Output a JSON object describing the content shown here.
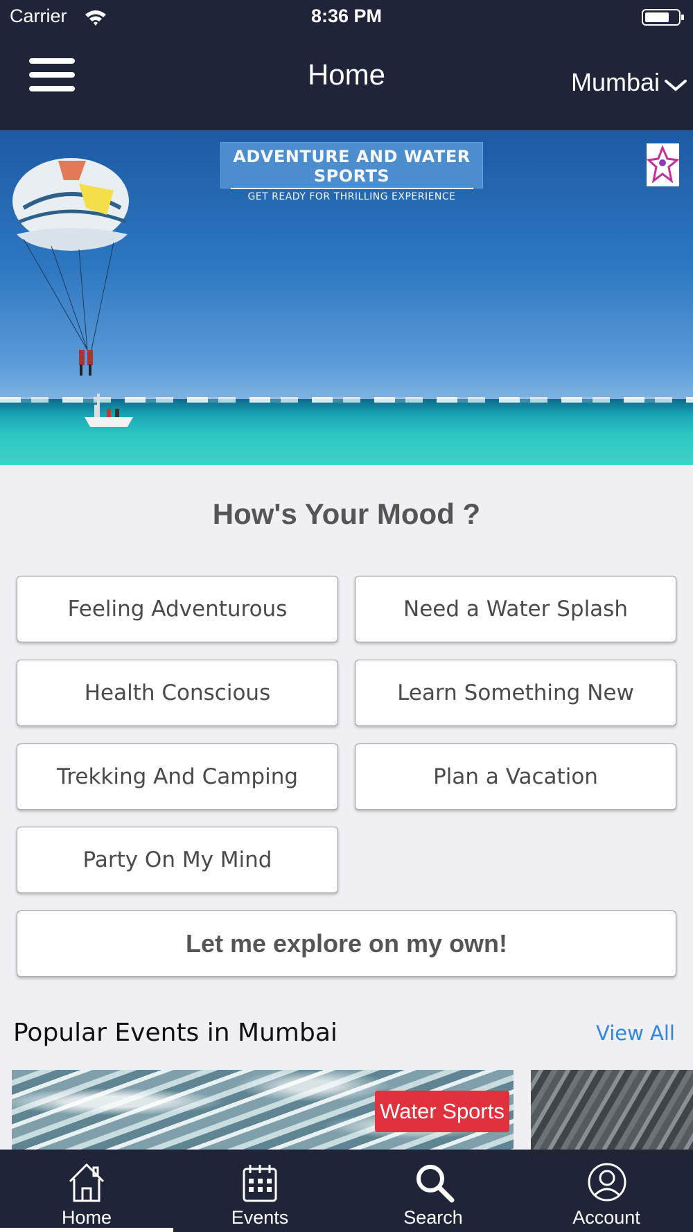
{
  "status_bar": {
    "carrier": "Carrier",
    "time": "8:36 PM"
  },
  "header": {
    "title": "Home",
    "city": "Mumbai"
  },
  "banner": {
    "headline": "ADVENTURE AND WATER SPORTS",
    "tagline": "GET READY FOR THRILLING EXPERIENCE"
  },
  "mood": {
    "title": "How's Your Mood ?",
    "options": [
      "Feeling Adventurous",
      "Need a Water Splash",
      "Health Conscious",
      "Learn Something New",
      "Trekking And Camping",
      "Plan a Vacation",
      "Party On My Mind"
    ],
    "explore_label": "Let me explore on my own!"
  },
  "popular": {
    "title": "Popular Events in Mumbai",
    "view_all": "View All",
    "cards": [
      {
        "category": "Water Sports"
      }
    ]
  },
  "tabs": [
    {
      "label": "Home",
      "icon": "home-icon",
      "active": true
    },
    {
      "label": "Events",
      "icon": "calendar-icon",
      "active": false
    },
    {
      "label": "Search",
      "icon": "search-icon",
      "active": false
    },
    {
      "label": "Account",
      "icon": "account-icon",
      "active": false
    }
  ],
  "colors": {
    "navy": "#1f2439",
    "background": "#efeff4",
    "link": "#2f86e0",
    "badge": "#e1313d"
  }
}
